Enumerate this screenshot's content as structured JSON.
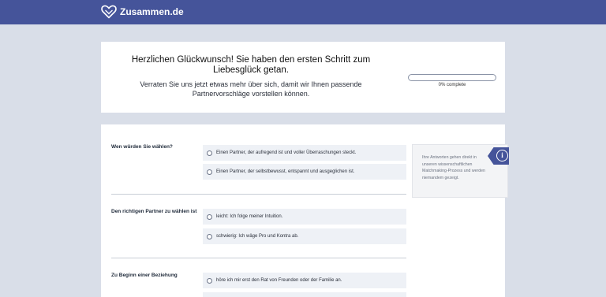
{
  "header": {
    "brand": "Zusammen.de",
    "logo_icon": "heart-logo-icon",
    "bg_color": "#45549a"
  },
  "intro": {
    "headline_line1": "Herzlichen Glückwunsch! Sie haben den ersten Schritt zum",
    "headline_line2": "Liebesglück getan.",
    "sub_line1": "Verraten Sie uns jetzt etwas mehr über sich, damit wir Ihnen passende",
    "sub_line2": "Partnervorschläge vorstellen können.",
    "progress_percent": 0,
    "progress_label": "0% complete"
  },
  "questions": [
    {
      "label": "Wen würden Sie wählen?",
      "options": [
        "Einen Partner, der aufregend ist und voller Überraschungen steckt.",
        "Einen Partner, der selbstbewusst, entspannt und ausgeglichen ist."
      ]
    },
    {
      "label": "Den richtigen Partner zu wählen ist",
      "options": [
        "leicht: Ich folge meiner Intuition.",
        "schwierig: Ich wäge Pro und Kontra ab."
      ]
    },
    {
      "label": "Zu Beginn einer Beziehung",
      "options": [
        "höre ich mir erst den Rat von Freunden oder der Familie an.",
        ""
      ]
    }
  ],
  "info": {
    "text": "Ihre Antworten gehen direkt in unseren wissenschaftlichen Matchmaking-Prozess und werden niemandem gezeigt.",
    "icon": "info-icon",
    "icon_glyph": "i"
  }
}
